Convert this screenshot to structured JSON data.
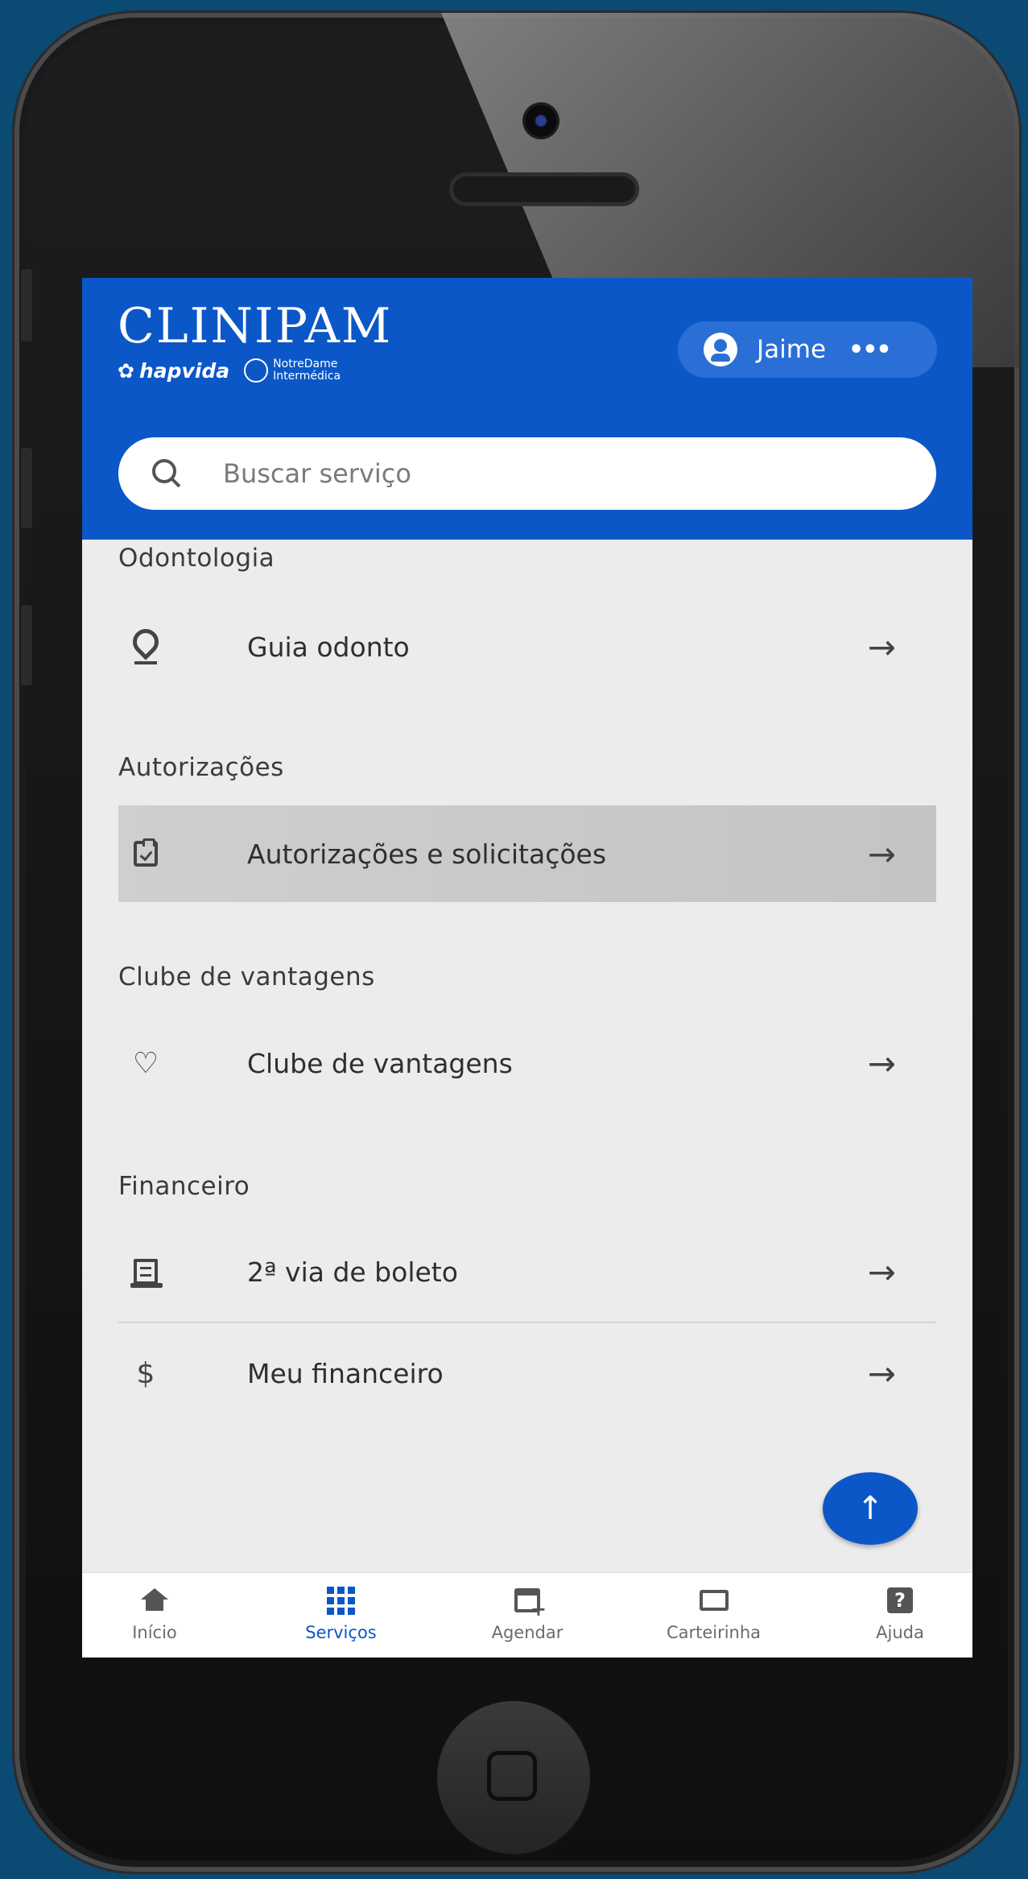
{
  "header": {
    "brand": "CLINIPAM",
    "sub_brand_1": "hapvida",
    "sub_brand_2_line1": "NotreDame",
    "sub_brand_2_line2": "Intermédica",
    "user_name": "Jaime",
    "more_label": "•••"
  },
  "search": {
    "placeholder": "Buscar serviço"
  },
  "sections": [
    {
      "title": "Odontologia",
      "items": [
        {
          "label": "Guia odonto",
          "icon": "map-pin-icon"
        }
      ]
    },
    {
      "title": "Autorizações",
      "items": [
        {
          "label": "Autorizações e solicitações",
          "icon": "clipboard-check-icon"
        }
      ]
    },
    {
      "title": "Clube de vantagens",
      "items": [
        {
          "label": "Clube de vantagens",
          "icon": "heart-icon"
        }
      ]
    },
    {
      "title": "Financeiro",
      "items": [
        {
          "label": "2ª via de boleto",
          "icon": "receipt-icon"
        },
        {
          "label": "Meu financeiro",
          "icon": "dollar-icon"
        }
      ]
    }
  ],
  "arrow_glyph": "→",
  "fab": {
    "icon": "↑"
  },
  "bottom_nav": [
    {
      "label": "Início",
      "icon": "home-icon"
    },
    {
      "label": "Serviços",
      "icon": "grid-icon",
      "active": true
    },
    {
      "label": "Agendar",
      "icon": "calendar-add-icon"
    },
    {
      "label": "Carteirinha",
      "icon": "card-icon"
    },
    {
      "label": "Ajuda",
      "icon": "help-icon"
    }
  ],
  "colors": {
    "primary": "#0b57c8",
    "background": "#ececec",
    "page_bg": "#0b4a73"
  }
}
